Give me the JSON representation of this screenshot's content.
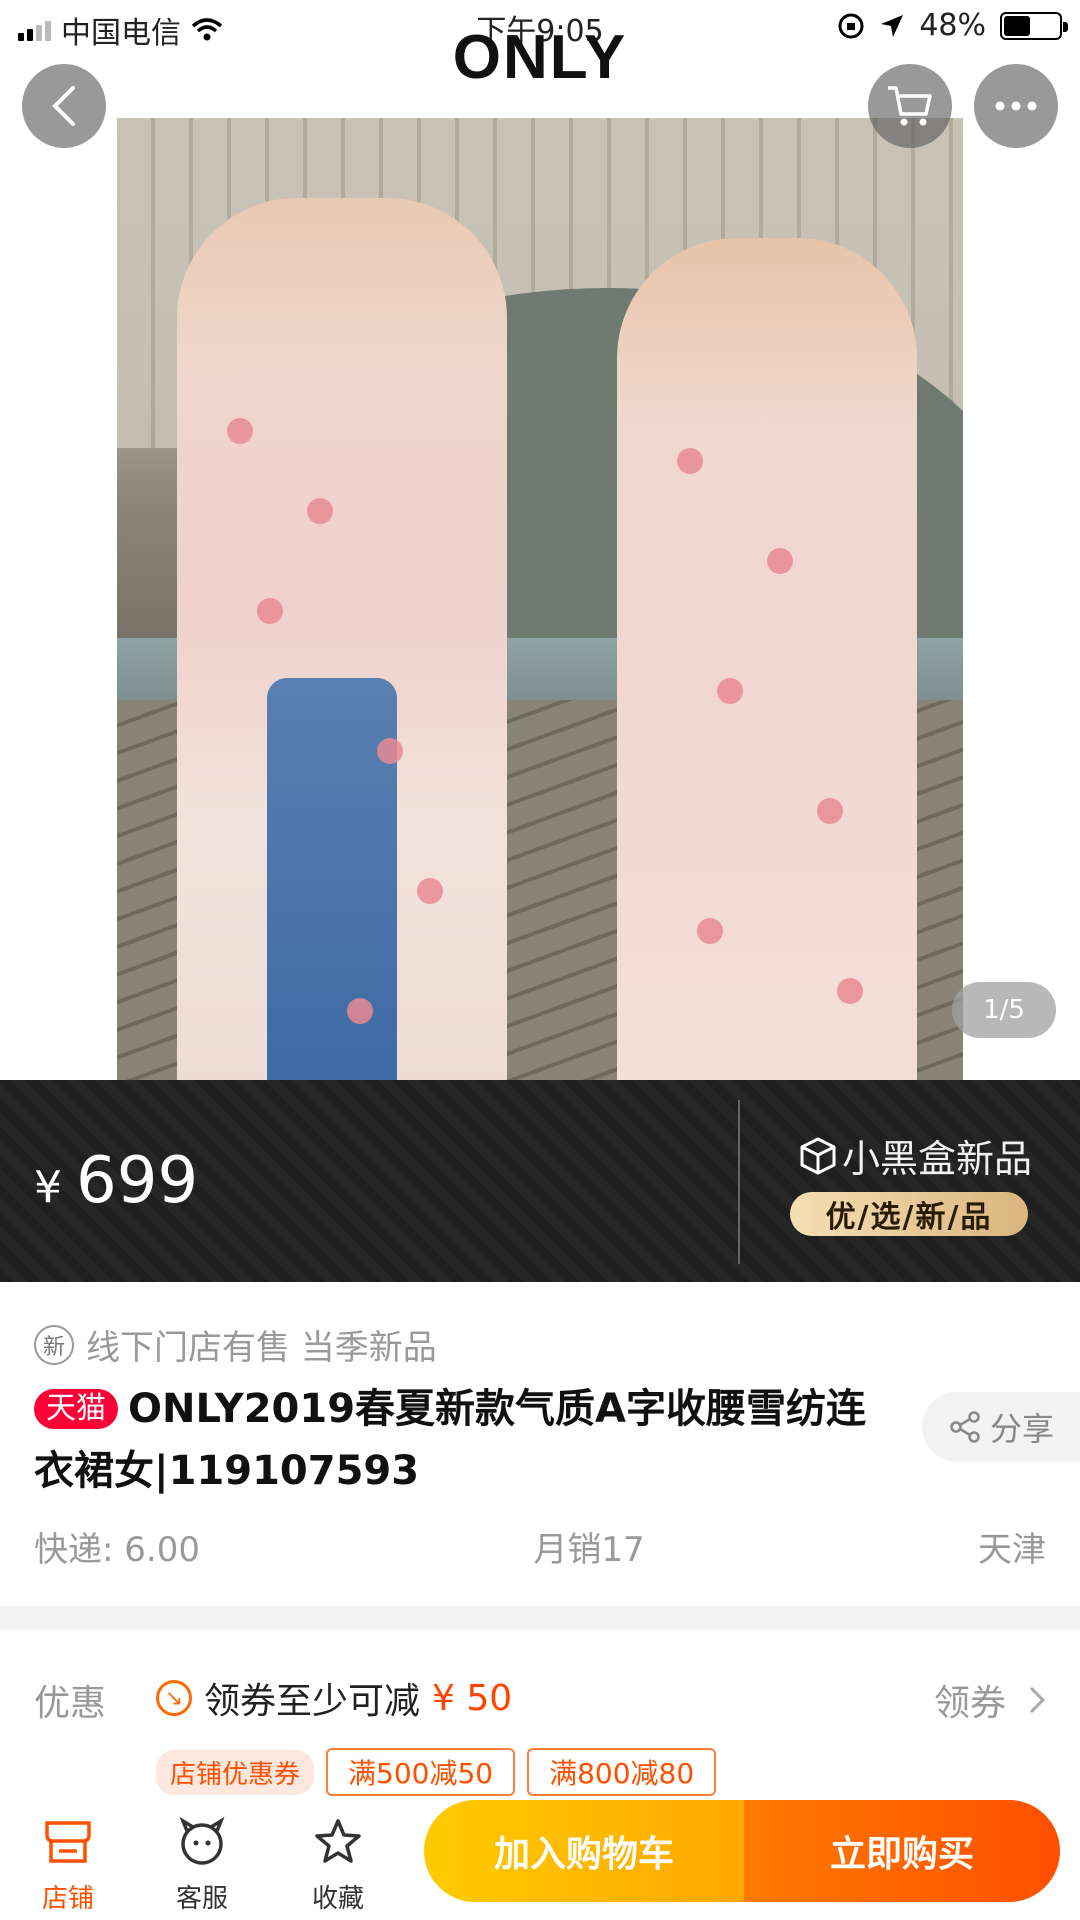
{
  "status_bar": {
    "carrier": "中国电信",
    "time": "下午9:05",
    "battery": "48%",
    "battery_level": 0.48
  },
  "brand": {
    "logo_text": "ONLY"
  },
  "hero": {
    "page_indicator": "1/5"
  },
  "price_banner": {
    "currency": "¥",
    "price": "699",
    "promo_title": "小黑盒新品",
    "promo_tag": "优/选/新/品"
  },
  "product": {
    "new_badge": "新",
    "subtitle": "线下门店有售 当季新品",
    "tmall_badge": "天猫",
    "title": "ONLY2019春夏新款气质A字收腰雪纺连衣裙女|119107593",
    "share_label": "分享",
    "shipping": "快递: 6.00",
    "monthly_sales": "月销17",
    "location": "天津"
  },
  "coupon": {
    "label": "优惠",
    "text": "领券至少可减",
    "amount": "¥ 50",
    "action": "领券",
    "shop_tag": "店铺优惠券",
    "tags": [
      "满500减50",
      "满800减80"
    ]
  },
  "bottom_bar": {
    "tabs": [
      {
        "label": "店铺",
        "icon": "shop-icon"
      },
      {
        "label": "客服",
        "icon": "service-icon"
      },
      {
        "label": "收藏",
        "icon": "star-icon"
      }
    ],
    "add_to_cart": "加入购物车",
    "buy_now": "立即购买"
  },
  "colors": {
    "accent_orange": "#ff5000",
    "tmall_red": "#ff0036",
    "cart_yellow": "#ffb400",
    "dark_banner": "#222222",
    "gold_tag": "#d9b57d"
  }
}
